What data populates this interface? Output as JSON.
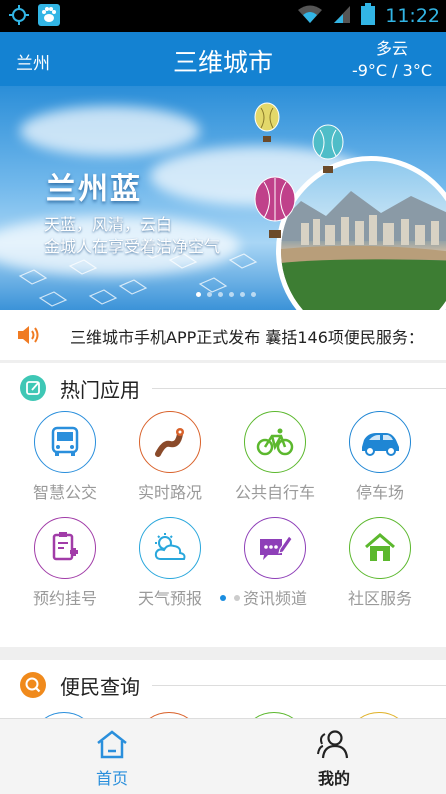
{
  "status_bar": {
    "time": "11:22"
  },
  "header": {
    "city": "兰州",
    "title": "三维城市",
    "weather_condition": "多云",
    "temperature": "-9°C / 3°C"
  },
  "banner": {
    "title": "兰州蓝",
    "subtitle_line1": "天蓝，风清，云白",
    "subtitle_line2": "金城人在享受着洁净空气",
    "slide_count": 6,
    "active_slide": 0
  },
  "ticker": {
    "text": "三维城市手机APP正式发布 囊括146项便民服务："
  },
  "hot_apps": {
    "heading": "热门应用",
    "items": [
      {
        "label": "智慧公交",
        "icon": "bus-icon",
        "color": "#2a8fdc"
      },
      {
        "label": "实时路况",
        "icon": "road-icon",
        "color": "#d9622b"
      },
      {
        "label": "公共自行车",
        "icon": "bicycle-icon",
        "color": "#5cb82e"
      },
      {
        "label": "停车场",
        "icon": "car-icon",
        "color": "#1f86d4"
      },
      {
        "label": "预约挂号",
        "icon": "hospital-register-icon",
        "color": "#a13ca8"
      },
      {
        "label": "天气预报",
        "icon": "weather-icon",
        "color": "#29a7dc"
      },
      {
        "label": "资讯频道",
        "icon": "news-icon",
        "color": "#8e3fb8"
      },
      {
        "label": "社区服务",
        "icon": "community-home-icon",
        "color": "#5cb82e"
      }
    ],
    "pages": 2,
    "active_page": 0
  },
  "convenience": {
    "heading": "便民查询"
  },
  "tabbar": {
    "home_label": "首页",
    "mine_label": "我的",
    "active_color": "#2a8fdc"
  }
}
